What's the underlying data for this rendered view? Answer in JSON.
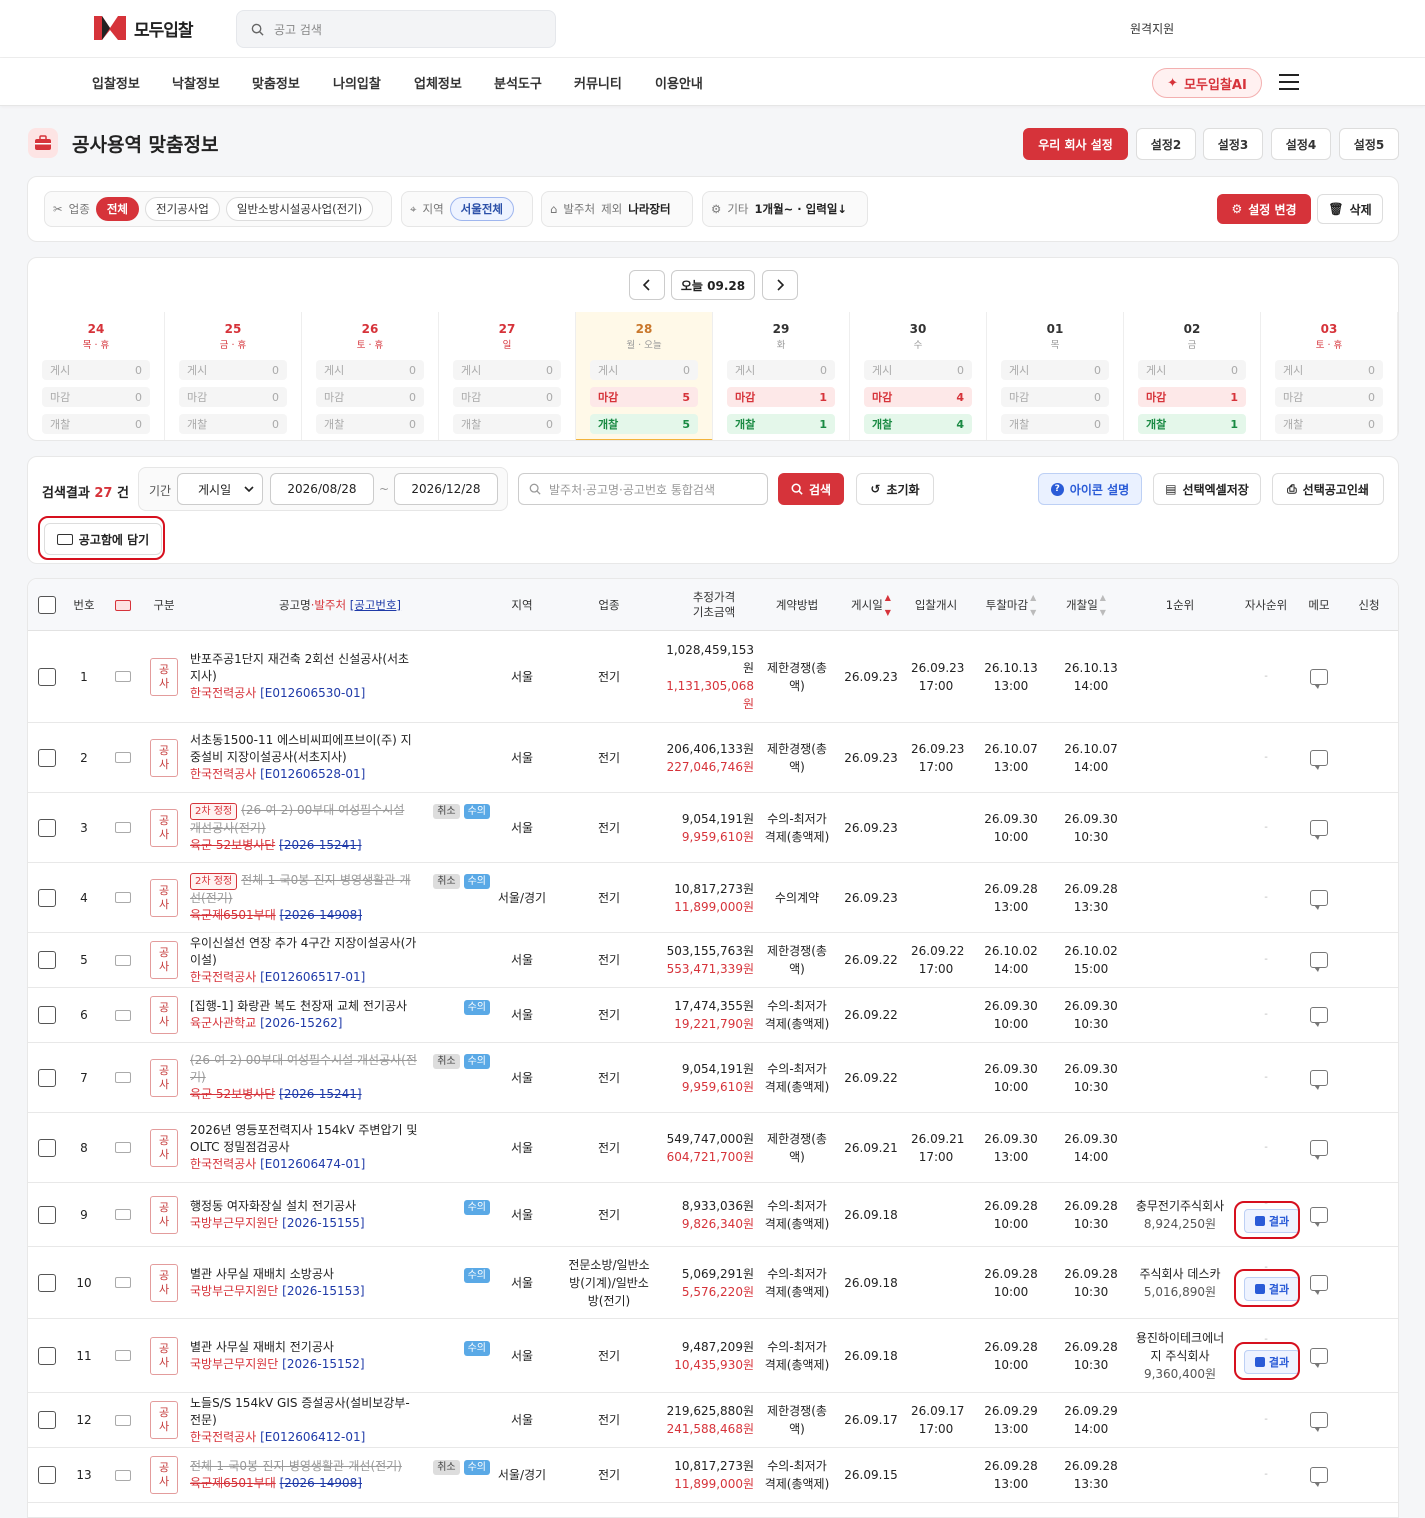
{
  "header": {
    "logo_text": "모두입찰",
    "search_placeholder": "공고 검색",
    "remote": "원격지원"
  },
  "nav": {
    "items": [
      "입찰정보",
      "낙찰정보",
      "맞춤정보",
      "나의입찰",
      "업체정보",
      "분석도구",
      "커뮤니티",
      "이용안내"
    ],
    "ai_label": "모두입찰AI"
  },
  "page": {
    "title": "공사용역 맞춤정보",
    "presets": [
      "우리 회사 설정",
      "설정2",
      "설정3",
      "설정4",
      "설정5"
    ]
  },
  "filters": {
    "biz_label": "업종",
    "biz_chips": [
      "전체",
      "전기공사업",
      "일반소방시설공사업(전기)"
    ],
    "region_label": "지역",
    "region_value": "서울전체",
    "owner_label": "발주처",
    "owner_exclude": "제외",
    "owner_value": "나라장터",
    "etc_label": "기타",
    "etc_value": "1개월~ · 입력일↓",
    "change_btn": "설정 변경",
    "delete_btn": "삭제"
  },
  "calendar": {
    "today_label": "오늘 09.28",
    "row_labels": [
      "게시",
      "마감",
      "개찰"
    ],
    "days": [
      {
        "num": "24",
        "sub": "목 · 휴",
        "post": "0",
        "close": "0",
        "open": "0",
        "color": "red"
      },
      {
        "num": "25",
        "sub": "금 · 휴",
        "post": "0",
        "close": "0",
        "open": "0",
        "color": "red"
      },
      {
        "num": "26",
        "sub": "토 · 휴",
        "post": "0",
        "close": "0",
        "open": "0",
        "color": "red"
      },
      {
        "num": "27",
        "sub": "일",
        "post": "0",
        "close": "0",
        "open": "0",
        "color": "red"
      },
      {
        "num": "28",
        "sub": "월 · 오늘",
        "post": "0",
        "close": "5",
        "open": "5",
        "color": "orange"
      },
      {
        "num": "29",
        "sub": "화",
        "post": "0",
        "close": "1",
        "open": "1",
        "color": ""
      },
      {
        "num": "30",
        "sub": "수",
        "post": "0",
        "close": "4",
        "open": "4",
        "color": ""
      },
      {
        "num": "01",
        "sub": "목",
        "post": "0",
        "close": "0",
        "open": "0",
        "color": ""
      },
      {
        "num": "02",
        "sub": "금",
        "post": "0",
        "close": "1",
        "open": "1",
        "color": ""
      },
      {
        "num": "03",
        "sub": "토 · 휴",
        "post": "0",
        "close": "0",
        "open": "0",
        "color": "red"
      }
    ]
  },
  "search": {
    "result_prefix": "검색결과",
    "result_count": "27",
    "result_suffix": "건",
    "period_label": "기간",
    "date_type": "게시일",
    "date_from": "2026/08/28",
    "tilde": "~",
    "date_to": "2026/12/28",
    "query_placeholder": "발주처·공고명·공고번호 통합검색",
    "search_btn": "검색",
    "reset_btn": "초기화",
    "icon_help": "아이콘 설명",
    "excel_btn": "선택엑셀저장",
    "print_btn": "선택공고인쇄",
    "basket_btn": "공고함에 담기"
  },
  "table": {
    "headers": {
      "no": "번호",
      "gubun": "구분",
      "title_a": "공고명",
      "title_dot": " · ",
      "title_b": "발주처",
      "title_c": "[공고번호]",
      "region": "지역",
      "biz": "업종",
      "price_a": "추정가격",
      "price_b": "기초금액",
      "method": "계약방법",
      "post": "게시일",
      "open_bid": "입찰개시",
      "close": "투찰마감",
      "open": "개찰일",
      "first": "1순위",
      "rank": "자사순위",
      "memo": "메모",
      "apply": "신청"
    },
    "gubun_a": "공",
    "gubun_b": "사",
    "dash": "-",
    "result_label": "결과",
    "rows": [
      {
        "no": "1",
        "tag": "",
        "title": "반포주공1단지 재건축 2회선 신설공사(서초지사)",
        "org": "한국전력공사",
        "bid": "[E012606530-01]",
        "struck": false,
        "cancel": "",
        "sue": "",
        "region": "서울",
        "biz": "전기",
        "est": "1,028,459,153원",
        "base": "1,131,305,068원",
        "method": "제한경쟁(총액)",
        "post": "26.09.23",
        "bidopen": "26.09.23 17:00",
        "close": "26.10.13 13:00",
        "open": "26.10.13 14:00",
        "first": "",
        "first_amt": ""
      },
      {
        "no": "2",
        "tag": "",
        "title": "서초동1500-11 에스비씨피에프브이(주) 지중설비 지장이설공사(서초지사)",
        "org": "한국전력공사",
        "bid": "[E012606528-01]",
        "struck": false,
        "cancel": "",
        "sue": "",
        "region": "서울",
        "biz": "전기",
        "est": "206,406,133원",
        "base": "227,046,746원",
        "method": "제한경쟁(총액)",
        "post": "26.09.23",
        "bidopen": "26.09.23 17:00",
        "close": "26.10.07 13:00",
        "open": "26.10.07 14:00",
        "first": "",
        "first_amt": ""
      },
      {
        "no": "3",
        "tag": "2차 정정",
        "title": "(26-여-2) 00부대 여성필수시설 개선공사(전기)",
        "org": "육군 52보병사단",
        "bid": "[2026-15241]",
        "struck": true,
        "cancel": "취소",
        "sue": "수의",
        "region": "서울",
        "biz": "전기",
        "est": "9,054,191원",
        "base": "9,959,610원",
        "method": "수의-최저가격제(총액제)",
        "post": "26.09.23",
        "bidopen": "",
        "close": "26.09.30 10:00",
        "open": "26.09.30 10:30",
        "first": "",
        "first_amt": ""
      },
      {
        "no": "4",
        "tag": "2차 정정",
        "title": "전체-1-국0봉-진지-병영생활관-개선(전기)",
        "org": "육군제6501부대",
        "bid": "[2026-14908]",
        "struck": true,
        "cancel": "취소",
        "sue": "수의",
        "region": "서울/경기",
        "biz": "전기",
        "est": "10,817,273원",
        "base": "11,899,000원",
        "method": "수의계약",
        "post": "26.09.23",
        "bidopen": "",
        "close": "26.09.28 13:00",
        "open": "26.09.28 13:30",
        "first": "",
        "first_amt": ""
      },
      {
        "no": "5",
        "tag": "",
        "title": "우이신설선 연장 추가 4구간 지장이설공사(가이설)",
        "org": "한국전력공사",
        "bid": "[E012606517-01]",
        "struck": false,
        "cancel": "",
        "sue": "",
        "region": "서울",
        "biz": "전기",
        "est": "503,155,763원",
        "base": "553,471,339원",
        "method": "제한경쟁(총액)",
        "post": "26.09.22",
        "bidopen": "26.09.22 17:00",
        "close": "26.10.02 14:00",
        "open": "26.10.02 15:00",
        "first": "",
        "first_amt": ""
      },
      {
        "no": "6",
        "tag": "",
        "title": "[집행-1] 화랑관 복도 천장재 교체 전기공사",
        "org": "육군사관학교",
        "bid": "[2026-15262]",
        "struck": false,
        "cancel": "",
        "sue": "수의",
        "region": "서울",
        "biz": "전기",
        "est": "17,474,355원",
        "base": "19,221,790원",
        "method": "수의-최저가격제(총액제)",
        "post": "26.09.22",
        "bidopen": "",
        "close": "26.09.30 10:00",
        "open": "26.09.30 10:30",
        "first": "",
        "first_amt": ""
      },
      {
        "no": "7",
        "tag": "",
        "title": "(26-여-2) 00부대 여성필수시설 개선공사(전기)",
        "org": "육군 52보병사단",
        "bid": "[2026-15241]",
        "struck": true,
        "cancel": "취소",
        "sue": "수의",
        "region": "서울",
        "biz": "전기",
        "est": "9,054,191원",
        "base": "9,959,610원",
        "method": "수의-최저가격제(총액제)",
        "post": "26.09.22",
        "bidopen": "",
        "close": "26.09.30 10:00",
        "open": "26.09.30 10:30",
        "first": "",
        "first_amt": ""
      },
      {
        "no": "8",
        "tag": "",
        "title": "2026년 영등포전력지사 154kV 주변압기 및 OLTC 정밀점검공사",
        "org": "한국전력공사",
        "bid": "[E012606474-01]",
        "struck": false,
        "cancel": "",
        "sue": "",
        "region": "서울",
        "biz": "전기",
        "est": "549,747,000원",
        "base": "604,721,700원",
        "method": "제한경쟁(총액)",
        "post": "26.09.21",
        "bidopen": "26.09.21 17:00",
        "close": "26.09.30 13:00",
        "open": "26.09.30 14:00",
        "first": "",
        "first_amt": ""
      },
      {
        "no": "9",
        "tag": "",
        "title": "행정동 여자화장실 설치 전기공사",
        "org": "국방부근무지원단",
        "bid": "[2026-15155]",
        "struck": false,
        "cancel": "",
        "sue": "수의",
        "region": "서울",
        "biz": "전기",
        "est": "8,933,036원",
        "base": "9,826,340원",
        "method": "수의-최저가격제(총액제)",
        "post": "26.09.18",
        "bidopen": "",
        "close": "26.09.28 10:00",
        "open": "26.09.28 10:30",
        "first": "충무전기주식회사",
        "first_amt": "8,924,250원"
      },
      {
        "no": "10",
        "tag": "",
        "title": "별관 사무실 재배치 소방공사",
        "org": "국방부근무지원단",
        "bid": "[2026-15153]",
        "struck": false,
        "cancel": "",
        "sue": "수의",
        "region": "서울",
        "biz": "전문소방/일반소방(기계)/일반소방(전기)",
        "est": "5,069,291원",
        "base": "5,576,220원",
        "method": "수의-최저가격제(총액제)",
        "post": "26.09.18",
        "bidopen": "",
        "close": "26.09.28 10:00",
        "open": "26.09.28 10:30",
        "first": "주식회사 데스카",
        "first_amt": "5,016,890원"
      },
      {
        "no": "11",
        "tag": "",
        "title": "별관 사무실 재배치 전기공사",
        "org": "국방부근무지원단",
        "bid": "[2026-15152]",
        "struck": false,
        "cancel": "",
        "sue": "수의",
        "region": "서울",
        "biz": "전기",
        "est": "9,487,209원",
        "base": "10,435,930원",
        "method": "수의-최저가격제(총액제)",
        "post": "26.09.18",
        "bidopen": "",
        "close": "26.09.28 10:00",
        "open": "26.09.28 10:30",
        "first": "용진하이테크에너지 주식회사",
        "first_amt": "9,360,400원"
      },
      {
        "no": "12",
        "tag": "",
        "title": "노들S/S 154kV GIS 증설공사(설비보강부-전문)",
        "org": "한국전력공사",
        "bid": "[E012606412-01]",
        "struck": false,
        "cancel": "",
        "sue": "",
        "region": "서울",
        "biz": "전기",
        "est": "219,625,880원",
        "base": "241,588,468원",
        "method": "제한경쟁(총액)",
        "post": "26.09.17",
        "bidopen": "26.09.17 17:00",
        "close": "26.09.29 13:00",
        "open": "26.09.29 14:00",
        "first": "",
        "first_amt": ""
      },
      {
        "no": "13",
        "tag": "",
        "title": "전체-1-국0봉-진지-병영생활관-개선(전기)",
        "org": "육군제6501부대",
        "bid": "[2026-14908]",
        "struck": true,
        "cancel": "취소",
        "sue": "수의",
        "region": "서울/경기",
        "biz": "전기",
        "est": "10,817,273원",
        "base": "11,899,000원",
        "method": "수의-최저가격제(총액제)",
        "post": "26.09.15",
        "bidopen": "",
        "close": "26.09.28 13:00",
        "open": "26.09.28 13:30",
        "first": "",
        "first_amt": ""
      }
    ]
  }
}
